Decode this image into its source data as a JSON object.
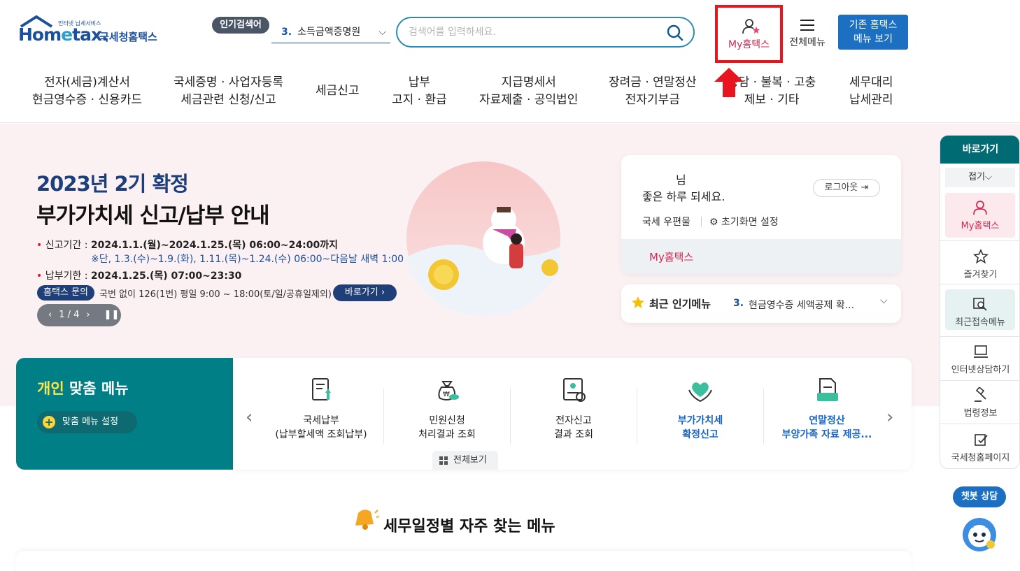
{
  "header": {
    "logo_tag": "인터넷 납세서비스",
    "logo_main_1": "Hom",
    "logo_main_e": "e",
    "logo_main_2": "tax.",
    "logo_kr": "국세청홈택스",
    "popular_label": "인기검색어",
    "popular_rank": "3.",
    "popular_keyword": "소득금액증명원",
    "search_placeholder": "검색어를 입력하세요.",
    "my_hometax": "My홈택스",
    "all_menu": "전체메뉴",
    "legacy_line1": "기존 홈택스",
    "legacy_line2": "메뉴 보기"
  },
  "nav": [
    {
      "l1": "전자(세금)계산서",
      "l2": "현금영수증 · 신용카드"
    },
    {
      "l1": "국세증명 · 사업자등록",
      "l2": "세금관련 신청/신고"
    },
    {
      "l1": "세금신고",
      "l2": ""
    },
    {
      "l1": "납부",
      "l2": "고지 · 환급"
    },
    {
      "l1": "지급명세서",
      "l2": "자료제출 · 공익법인"
    },
    {
      "l1": "장려금 · 연말정산",
      "l2": "전자기부금"
    },
    {
      "l1": "상담 · 불복 · 고충",
      "l2": "제보 · 기타"
    },
    {
      "l1": "세무대리",
      "l2": "납세관리"
    }
  ],
  "hero": {
    "title1": "2023년 2기 확정",
    "title2": "부가가치세 신고/납부 안내",
    "period_label": "신고기간 :",
    "period_value": "2024.1.1.(월)~2024.1.25.(목) 06:00~24:00까지",
    "period_note": "※단, 1.3.(수)~1.9.(화), 1.11.(목)~1.24.(수) 06:00~다음날 새벽 1:00",
    "due_label": "납부기한 :",
    "due_value": "2024.1.25.(목) 07:00~23:30",
    "inquiry_badge": "홈택스 문의",
    "inquiry_text": "국번 없이 126(1번) 평일 9:00 ~ 18:00(토/일/공휴일제외)",
    "go_button": "바로가기",
    "pager": "1 / 4"
  },
  "login": {
    "name_suffix": "님",
    "greeting": "좋은 하루 되세요.",
    "logout": "로그아웃",
    "post": "국세 우편물",
    "init_setting": "초기화면 설정",
    "my_hometax": "My홈택스"
  },
  "recent": {
    "label": "최근 인기메뉴",
    "rank": "3.",
    "value": "현금영수증 세액공제 확..."
  },
  "personal_menu": {
    "title_hl": "개인",
    "title_rest": "맞춤 메뉴",
    "settings": "맞춤 메뉴 설정",
    "view_all": "전체보기",
    "items": [
      {
        "t1": "국세납부",
        "t2": "(납부할세액 조회납부)"
      },
      {
        "t1": "민원신청",
        "t2": "처리결과 조회"
      },
      {
        "t1": "전자신고",
        "t2": "결과 조회"
      },
      {
        "t1": "부가가치세",
        "t2": "확정신고"
      },
      {
        "t1": "연말정산",
        "t2": "부양가족 자료 제공..."
      }
    ]
  },
  "schedule": {
    "title": "세무일정별 자주 찾는 메뉴"
  },
  "quick": {
    "head": "바로가기",
    "fold": "접기",
    "items": [
      "My홈택스",
      "즐겨찾기",
      "최근접속메뉴",
      "인터넷상담하기",
      "법령정보",
      "국세청홈페이지"
    ]
  },
  "chatbot": {
    "label": "챗봇 상담"
  },
  "colors": {
    "brand_blue": "#1c4f9c",
    "teal": "#007f86",
    "accent_pink": "#d3294f",
    "highlight_red": "#e8141e"
  }
}
